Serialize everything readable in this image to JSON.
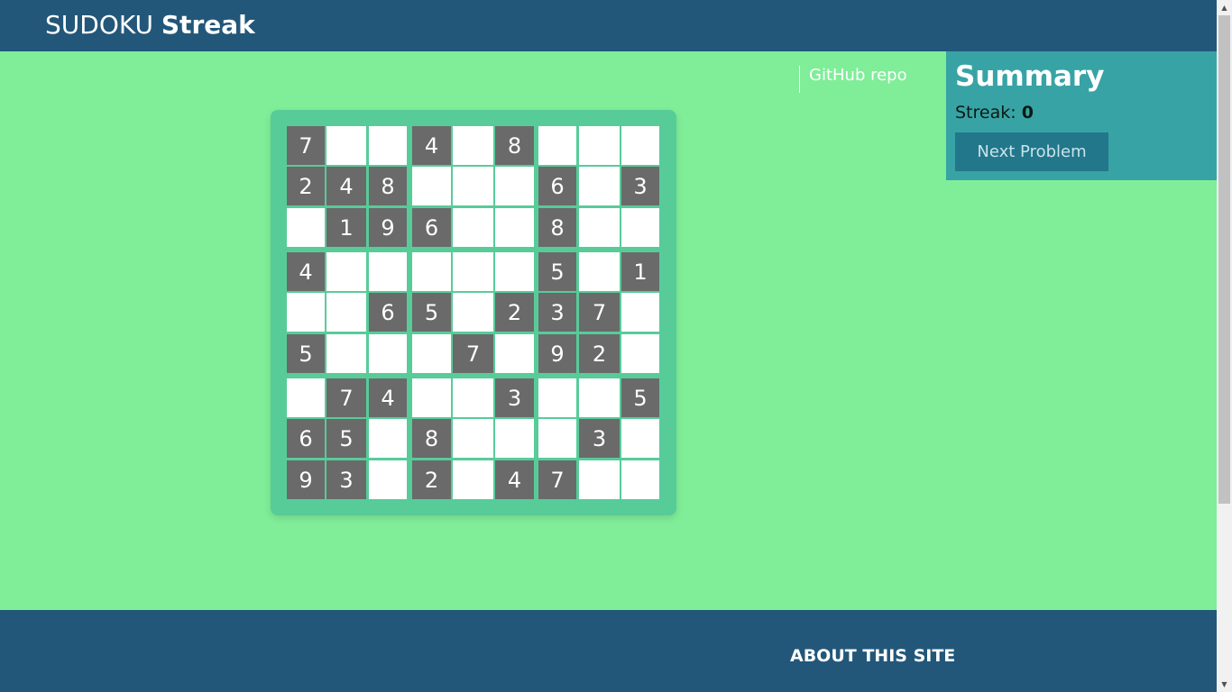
{
  "header": {
    "title_regular": "SUDOKU",
    "title_bold": "Streak"
  },
  "board": {
    "rows": [
      [
        "7",
        "",
        "",
        "4",
        "",
        "8",
        "",
        "",
        ""
      ],
      [
        "2",
        "4",
        "8",
        "",
        "",
        "",
        "6",
        "",
        "3"
      ],
      [
        "",
        "1",
        "9",
        "6",
        "",
        "",
        "8",
        "",
        ""
      ],
      [
        "4",
        "",
        "",
        "",
        "",
        "",
        "5",
        "",
        "1"
      ],
      [
        "",
        "",
        "6",
        "5",
        "",
        "2",
        "3",
        "7",
        ""
      ],
      [
        "5",
        "",
        "",
        "",
        "7",
        "",
        "9",
        "2",
        ""
      ],
      [
        "",
        "7",
        "4",
        "",
        "",
        "3",
        "",
        "",
        "5"
      ],
      [
        "6",
        "5",
        "",
        "8",
        "",
        "",
        "",
        "3",
        ""
      ],
      [
        "9",
        "3",
        "",
        "2",
        "",
        "4",
        "7",
        "",
        ""
      ]
    ]
  },
  "summary": {
    "title": "Summary",
    "streak_label": "Streak:",
    "streak_value": "0",
    "next_button": "Next Problem"
  },
  "footer": {
    "heading": "ABOUT THIS SITE",
    "link": "GitHub repo"
  },
  "colors": {
    "header_bg": "#22577a",
    "page_bg": "#80ed99",
    "board_bg": "#57cc99",
    "given_cell": "#6a6a6a",
    "summary_bg": "#38a3a5"
  }
}
